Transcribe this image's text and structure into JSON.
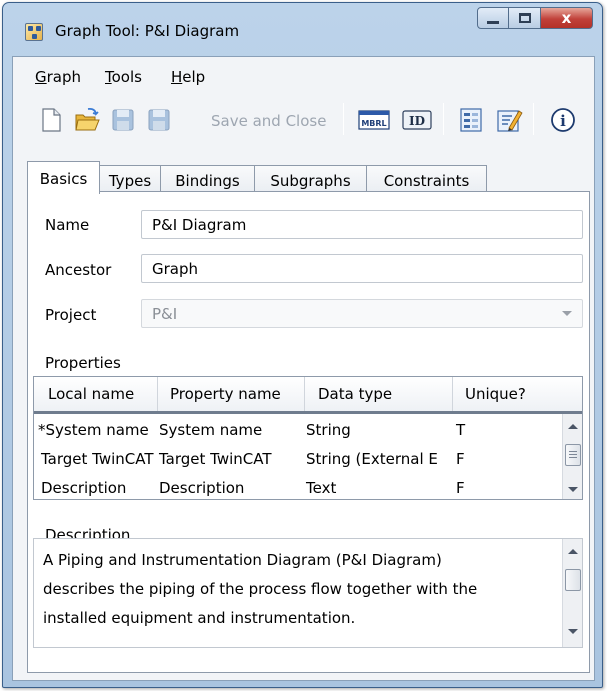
{
  "window": {
    "title": "Graph Tool: P&I Diagram",
    "close_glyph": "x"
  },
  "menu": [
    {
      "label": "Graph",
      "mnemonic": "G"
    },
    {
      "label": "Tools",
      "mnemonic": "T"
    },
    {
      "label": "Help",
      "mnemonic": "H"
    }
  ],
  "toolbar": {
    "save_close_label": "Save and Close",
    "mbrl_label": "MBRL",
    "id_label": "ID",
    "info_label": "i",
    "icons": [
      "new-document-icon",
      "open-folder-icon",
      "save-icon",
      "save-and-close-icon",
      "mbrl-icon",
      "id-icon",
      "form-icon",
      "edit-icon",
      "info-icon"
    ]
  },
  "tabs": [
    "Basics",
    "Types",
    "Bindings",
    "Subgraphs",
    "Constraints"
  ],
  "active_tab": "Basics",
  "form": {
    "name_label": "Name",
    "name_value": "P&I Diagram",
    "ancestor_label": "Ancestor",
    "ancestor_value": "Graph",
    "project_label": "Project",
    "project_value": "P&I"
  },
  "properties": {
    "section_label": "Properties",
    "columns": [
      "Local name",
      "Property name",
      "Data type",
      "Unique?"
    ],
    "rows": [
      [
        "*System name",
        "System name",
        "String",
        "T"
      ],
      [
        "Target TwinCAT",
        "Target TwinCAT",
        "String (External E",
        "F"
      ],
      [
        "Description",
        "Description",
        "Text",
        "F"
      ]
    ]
  },
  "description": {
    "label": "Description",
    "lines": [
      "A Piping and Instrumentation Diagram (P&I Diagram)",
      "describes the piping of the process flow together with the",
      "installed equipment and instrumentation."
    ]
  },
  "colors": {
    "titlebar": "#b5cde6",
    "close_button": "#c1413a",
    "panel": "#ffffff",
    "chrome": "#f2f4f7"
  }
}
